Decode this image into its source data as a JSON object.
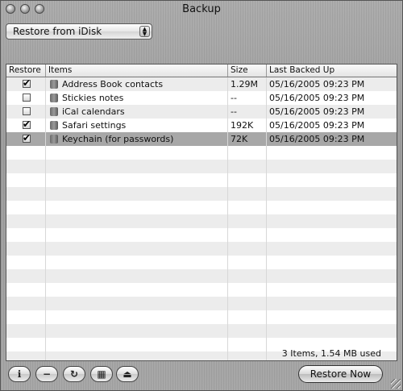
{
  "window": {
    "title": "Backup"
  },
  "popup": {
    "selected": "Restore from iDisk"
  },
  "table": {
    "columns": [
      "Restore",
      "Items",
      "Size",
      "Last Backed Up"
    ],
    "rows": [
      {
        "restore": true,
        "item": "Address Book contacts",
        "size": "1.29M",
        "last": "05/16/2005 09:23 PM"
      },
      {
        "restore": false,
        "item": "Stickies notes",
        "size": "--",
        "last": "05/16/2005 09:23 PM"
      },
      {
        "restore": false,
        "item": "iCal calendars",
        "size": "--",
        "last": "05/16/2005 09:23 PM"
      },
      {
        "restore": true,
        "item": "Safari settings",
        "size": "192K",
        "last": "05/16/2005 09:23 PM"
      },
      {
        "restore": true,
        "item": "Keychain (for passwords)",
        "size": "72K",
        "last": "05/16/2005 09:23 PM"
      }
    ]
  },
  "status": "3 Items, 1.54 MB used",
  "toolbar": {
    "info_icon": "info-icon",
    "minus_icon": "minus-icon",
    "refresh_icon": "refresh-icon",
    "calculator_icon": "calculator-icon",
    "eject_icon": "eject-icon",
    "restore_now": "Restore Now"
  },
  "colors": {
    "selection": "#a7a7a7",
    "stripe": "#ececec"
  }
}
